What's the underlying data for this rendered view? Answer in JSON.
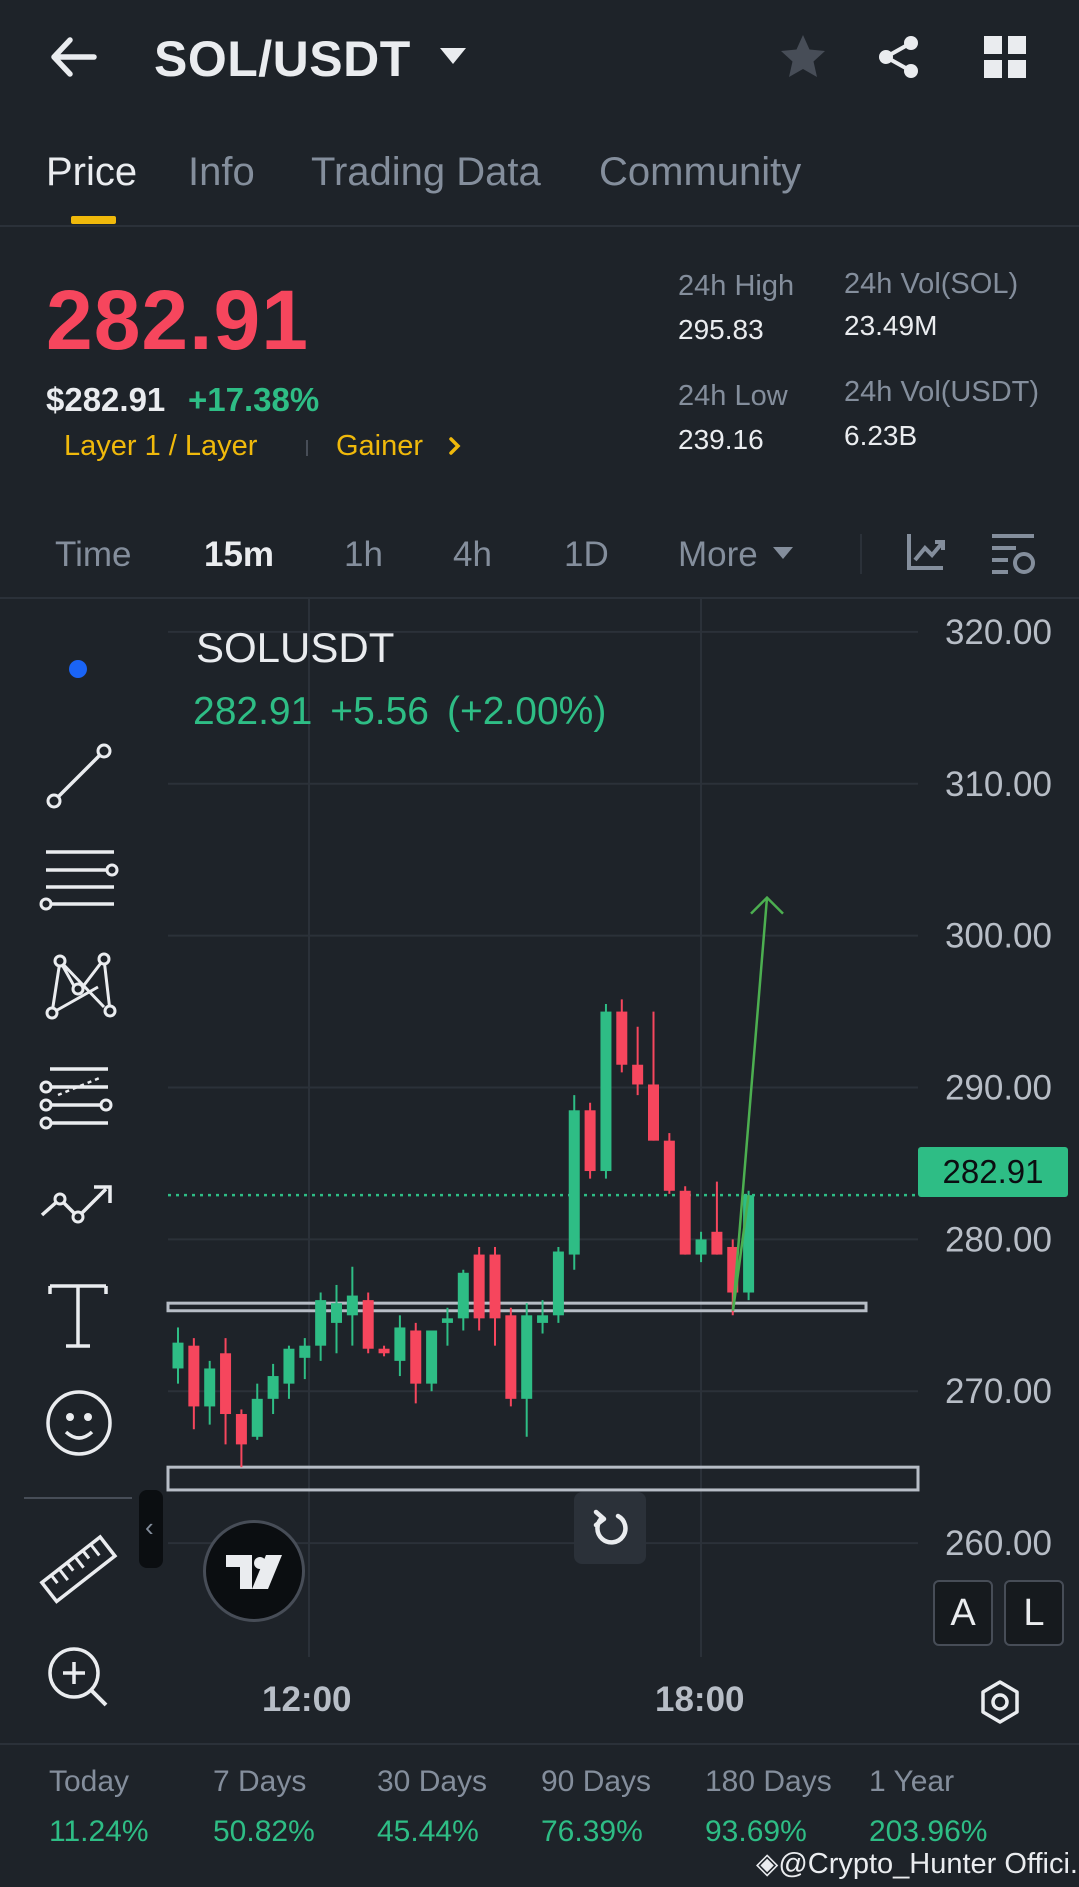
{
  "header": {
    "pair": "SOL/USDT"
  },
  "tabs": [
    "Price",
    "Info",
    "Trading Data",
    "Community"
  ],
  "price": {
    "last": "282.91",
    "usd": "$282.91",
    "change_pct": "+17.38%",
    "tag_layer": "Layer 1 / Layer",
    "tag_gainer": "Gainer"
  },
  "stats": {
    "high_label": "24h High",
    "high_value": "295.83",
    "low_label": "24h Low",
    "low_value": "239.16",
    "vol_base_label": "24h Vol(SOL)",
    "vol_base_value": "23.49M",
    "vol_quote_label": "24h Vol(USDT)",
    "vol_quote_value": "6.23B"
  },
  "intervals": [
    "Time",
    "15m",
    "1h",
    "4h",
    "1D",
    "More"
  ],
  "chart": {
    "symbol": "SOLUSDT",
    "last": "282.91",
    "change": "+5.56",
    "change_pct": "(+2.00%)",
    "price_tag": "282.91",
    "btn_a": "A",
    "btn_l": "L"
  },
  "chart_data": {
    "type": "candlestick",
    "y_ticks": [
      "320.00",
      "310.00",
      "300.00",
      "290.00",
      "280.00",
      "270.00",
      "260.00"
    ],
    "ylim": [
      252.5,
      322.3
    ],
    "x_ticks": [
      "12:00",
      "18:00"
    ],
    "last_price_line": 282.91,
    "support_zones": [
      [
        275.3,
        275.8
      ],
      [
        263.5,
        265.0
      ]
    ],
    "projection_arrow": [
      [
        275.3,
        300
      ]
    ],
    "candles": [
      {
        "o": 271.5,
        "h": 274.2,
        "l": 270.5,
        "c": 273.2
      },
      {
        "o": 273.0,
        "h": 273.5,
        "l": 267.5,
        "c": 269.0
      },
      {
        "o": 269.0,
        "h": 272.0,
        "l": 267.8,
        "c": 271.5
      },
      {
        "o": 272.5,
        "h": 273.5,
        "l": 266.5,
        "c": 268.5
      },
      {
        "o": 268.5,
        "h": 268.8,
        "l": 265.0,
        "c": 266.5
      },
      {
        "o": 267.0,
        "h": 270.5,
        "l": 266.8,
        "c": 269.5
      },
      {
        "o": 269.5,
        "h": 271.8,
        "l": 268.5,
        "c": 271.0
      },
      {
        "o": 270.5,
        "h": 273.0,
        "l": 269.5,
        "c": 272.8
      },
      {
        "o": 272.2,
        "h": 273.5,
        "l": 270.8,
        "c": 273.0
      },
      {
        "o": 273.0,
        "h": 276.5,
        "l": 272.0,
        "c": 276.0
      },
      {
        "o": 274.5,
        "h": 277.0,
        "l": 272.5,
        "c": 275.8
      },
      {
        "o": 275.0,
        "h": 278.2,
        "l": 273.0,
        "c": 276.3
      },
      {
        "o": 276.0,
        "h": 276.5,
        "l": 272.5,
        "c": 272.8
      },
      {
        "o": 272.8,
        "h": 273.0,
        "l": 272.3,
        "c": 272.5
      },
      {
        "o": 272.0,
        "h": 275.0,
        "l": 271.0,
        "c": 274.2
      },
      {
        "o": 274.0,
        "h": 274.5,
        "l": 269.2,
        "c": 270.5
      },
      {
        "o": 270.5,
        "h": 274.0,
        "l": 270.0,
        "c": 274.0
      },
      {
        "o": 274.5,
        "h": 275.5,
        "l": 273.0,
        "c": 274.8
      },
      {
        "o": 274.8,
        "h": 278.0,
        "l": 274.0,
        "c": 277.8
      },
      {
        "o": 279.0,
        "h": 279.5,
        "l": 274.0,
        "c": 274.8
      },
      {
        "o": 279.0,
        "h": 279.5,
        "l": 273.0,
        "c": 274.8
      },
      {
        "o": 275.0,
        "h": 275.5,
        "l": 269.0,
        "c": 269.5
      },
      {
        "o": 269.5,
        "h": 275.8,
        "l": 267.0,
        "c": 275.0
      },
      {
        "o": 274.5,
        "h": 276.0,
        "l": 273.8,
        "c": 275.0
      },
      {
        "o": 275.0,
        "h": 279.5,
        "l": 274.5,
        "c": 279.2
      },
      {
        "o": 279.0,
        "h": 289.5,
        "l": 278.0,
        "c": 288.5
      },
      {
        "o": 288.5,
        "h": 289.0,
        "l": 284.0,
        "c": 284.5
      },
      {
        "o": 284.5,
        "h": 295.5,
        "l": 284.0,
        "c": 295.0
      },
      {
        "o": 295.0,
        "h": 295.8,
        "l": 291.0,
        "c": 291.5
      },
      {
        "o": 291.5,
        "h": 294.0,
        "l": 289.5,
        "c": 290.2
      },
      {
        "o": 290.2,
        "h": 295.0,
        "l": 286.5,
        "c": 286.5
      },
      {
        "o": 286.5,
        "h": 287.0,
        "l": 283.0,
        "c": 283.2
      },
      {
        "o": 283.2,
        "h": 283.5,
        "l": 279.0,
        "c": 279.0
      },
      {
        "o": 279.0,
        "h": 280.5,
        "l": 278.5,
        "c": 280.0
      },
      {
        "o": 280.5,
        "h": 283.8,
        "l": 279.0,
        "c": 279.0
      },
      {
        "o": 279.5,
        "h": 280.0,
        "l": 275.0,
        "c": 276.5
      },
      {
        "o": 276.5,
        "h": 283.2,
        "l": 276.0,
        "c": 282.91
      }
    ]
  },
  "performance": [
    {
      "label": "Today",
      "value": "11.24%"
    },
    {
      "label": "7 Days",
      "value": "50.82%"
    },
    {
      "label": "30 Days",
      "value": "45.44%"
    },
    {
      "label": "90 Days",
      "value": "76.39%"
    },
    {
      "label": "180 Days",
      "value": "93.69%"
    },
    {
      "label": "1 Year",
      "value": "203.96%"
    }
  ],
  "watermark": "@Crypto_Hunter Offici...",
  "colors": {
    "up": "#2ebd85",
    "down": "#f6465d",
    "accent": "#f0b90b",
    "background": "#1e2329"
  }
}
